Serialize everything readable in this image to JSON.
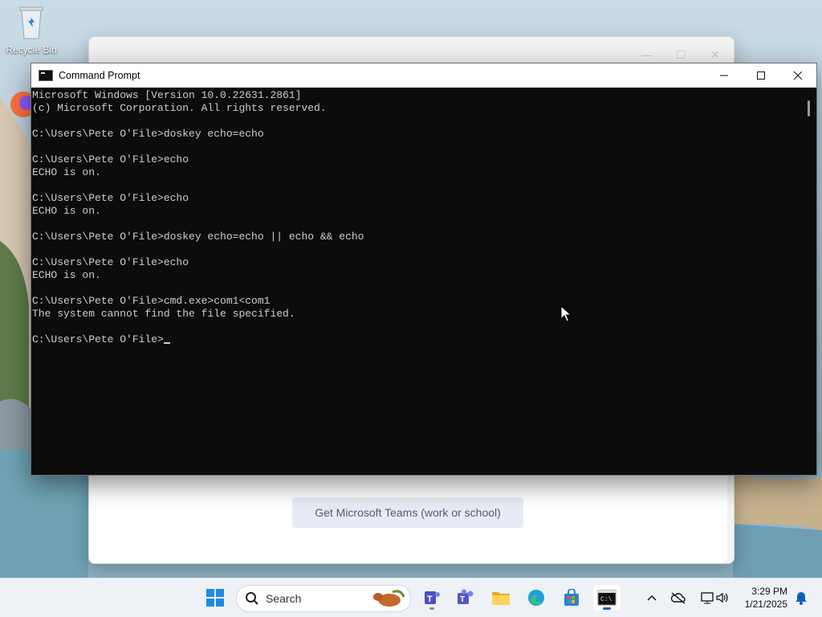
{
  "desktop": {
    "icons": [
      {
        "label": "Recycle Bin",
        "icon": "recycle-bin-icon"
      },
      {
        "label": "Firefox",
        "icon": "firefox-icon"
      }
    ]
  },
  "background_window": {
    "teams_button_label": "Get Microsoft Teams (work or school)"
  },
  "cmd_window": {
    "title": "Command Prompt",
    "lines": [
      "Microsoft Windows [Version 10.0.22631.2861]",
      "(c) Microsoft Corporation. All rights reserved.",
      "",
      "C:\\Users\\Pete O'File>doskey echo=echo",
      "",
      "C:\\Users\\Pete O'File>echo",
      "ECHO is on.",
      "",
      "C:\\Users\\Pete O'File>echo",
      "ECHO is on.",
      "",
      "C:\\Users\\Pete O'File>doskey echo=echo || echo && echo",
      "",
      "C:\\Users\\Pete O'File>echo",
      "ECHO is on.",
      "",
      "C:\\Users\\Pete O'File>cmd.exe>com1<com1",
      "The system cannot find the file specified.",
      ""
    ],
    "prompt": "C:\\Users\\Pete O'File>",
    "colors": {
      "background": "#0c0c0c",
      "text": "#cccccc"
    }
  },
  "taskbar": {
    "search_label": "Search",
    "apps": [
      "start-icon",
      "teams-chat-icon",
      "teams-icon",
      "file-explorer-icon",
      "edge-icon",
      "store-icon",
      "terminal-icon"
    ],
    "tray": {
      "time": "3:29 PM",
      "date": "1/21/2025"
    },
    "accent": "#0067c0"
  }
}
